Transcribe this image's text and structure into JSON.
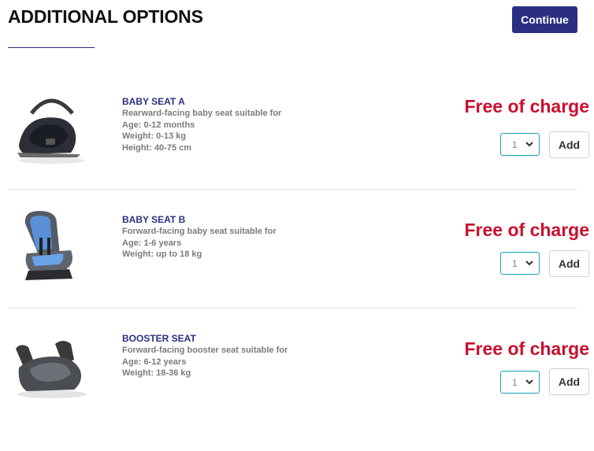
{
  "header": {
    "title": "ADDITIONAL OPTIONS",
    "continue_label": "Continue"
  },
  "options": [
    {
      "name": "BABY SEAT A",
      "description": [
        "Rearward-facing baby seat suitable for",
        "Age: 0-12 months",
        "Weight: 0-13 kg",
        "Height: 40-75 cm"
      ],
      "price": "Free of charge",
      "quantity": "1",
      "add_label": "Add",
      "icon": "infant-carrier-icon"
    },
    {
      "name": "BABY SEAT B",
      "description": [
        "Forward-facing baby seat suitable for",
        "Age: 1-6 years",
        "Weight: up to 18 kg"
      ],
      "price": "Free of charge",
      "quantity": "1",
      "add_label": "Add",
      "icon": "child-car-seat-icon"
    },
    {
      "name": "BOOSTER SEAT",
      "description": [
        "Forward-facing booster seat suitable for",
        "Age: 6-12 years",
        "Weight: 18-36 kg"
      ],
      "price": "Free of charge",
      "quantity": "1",
      "add_label": "Add",
      "icon": "booster-seat-icon"
    }
  ],
  "colors": {
    "brand": "#2b2f82",
    "price": "#c8102e",
    "select_border": "#17a2b8"
  }
}
